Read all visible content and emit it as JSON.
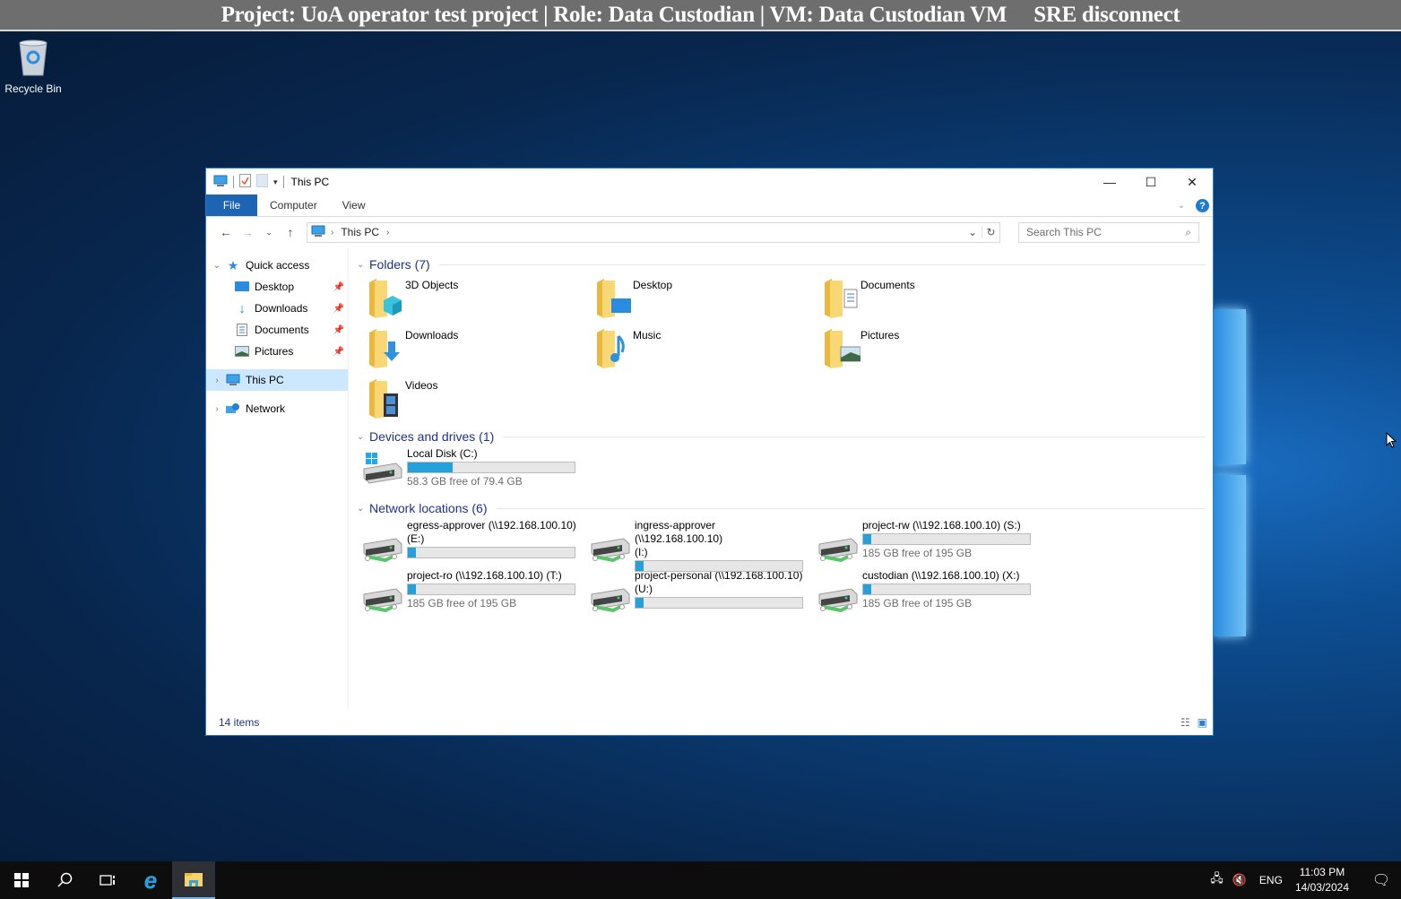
{
  "banner": {
    "text": "Project: UoA operator test project | Role: Data Custodian | VM: Data Custodian VM",
    "disconnect": "SRE disconnect"
  },
  "desktop": {
    "icons": [
      {
        "label": "Recycle Bin",
        "icon": "recycle-bin-icon"
      }
    ]
  },
  "window": {
    "title": "This PC",
    "controls": {
      "minimize": "—",
      "maximize": "☐",
      "close": "✕"
    },
    "ribbon_tabs": [
      "File",
      "Computer",
      "View"
    ],
    "help": "?",
    "address": {
      "crumbs": [
        "This PC"
      ]
    },
    "search": {
      "placeholder": "Search This PC"
    },
    "nav": {
      "quick_access": "Quick access",
      "quick_items": [
        {
          "label": "Desktop",
          "icon": "desktop-icon",
          "pinned": true
        },
        {
          "label": "Downloads",
          "icon": "downloads-icon",
          "pinned": true
        },
        {
          "label": "Documents",
          "icon": "documents-icon",
          "pinned": true
        },
        {
          "label": "Pictures",
          "icon": "pictures-icon",
          "pinned": true
        }
      ],
      "this_pc": "This PC",
      "network": "Network"
    },
    "groups": {
      "folders": {
        "title": "Folders (7)",
        "items": [
          "3D Objects",
          "Desktop",
          "Documents",
          "Downloads",
          "Music",
          "Pictures",
          "Videos"
        ]
      },
      "devices": {
        "title": "Devices and drives (1)",
        "items": [
          {
            "name": "Local Disk (C:)",
            "free_text": "58.3 GB free of 79.4 GB",
            "used_fraction": 0.27
          }
        ]
      },
      "network": {
        "title": "Network locations (6)",
        "items": [
          {
            "name": "egress-approver (\\\\192.168.100.10)",
            "name2": "(E:)",
            "free_text": "",
            "used_fraction": 0.05
          },
          {
            "name": "ingress-approver (\\\\192.168.100.10)",
            "name2": "(I:)",
            "free_text": "",
            "used_fraction": 0.05
          },
          {
            "name": "project-rw (\\\\192.168.100.10) (S:)",
            "name2": "",
            "free_text": "185 GB free of 195 GB",
            "used_fraction": 0.05
          },
          {
            "name": "project-ro (\\\\192.168.100.10) (T:)",
            "name2": "",
            "free_text": "185 GB free of 195 GB",
            "used_fraction": 0.05
          },
          {
            "name": "project-personal (\\\\192.168.100.10)",
            "name2": "(U:)",
            "free_text": "",
            "used_fraction": 0.05
          },
          {
            "name": "custodian (\\\\192.168.100.10) (X:)",
            "name2": "",
            "free_text": "185 GB free of 195 GB",
            "used_fraction": 0.05
          }
        ]
      }
    },
    "status": {
      "items": "14 items"
    }
  },
  "taskbar": {
    "lang": "ENG",
    "time": "11:03 PM",
    "date": "14/03/2024"
  },
  "colors": {
    "accent": "#1e64b4",
    "bar_fill": "#26a0da",
    "group_header": "#1e3287"
  }
}
